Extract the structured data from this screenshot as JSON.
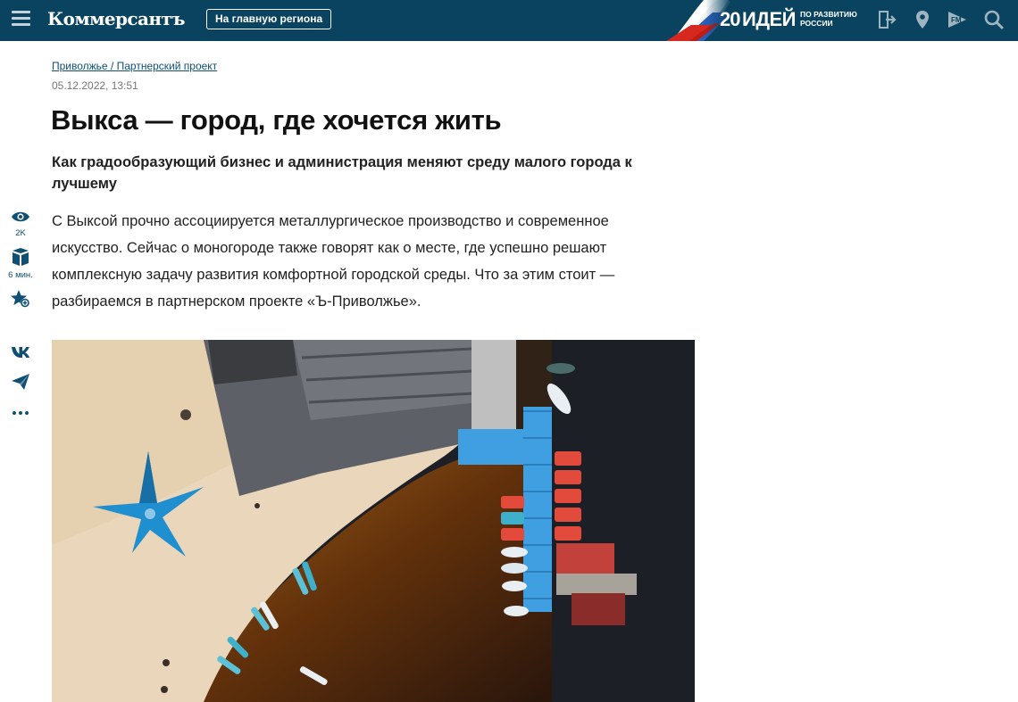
{
  "header": {
    "logo": "Коммерсантъ",
    "region_button": "На главную региона",
    "promo": {
      "number": "20",
      "word": "ИДЕЙ",
      "sub_line1": "ПО РАЗВИТИЮ",
      "sub_line2": "РОССИИ"
    },
    "icons": [
      "login-icon",
      "location-pin-icon",
      "radio-fm-icon",
      "search-icon"
    ]
  },
  "article": {
    "breadcrumb": "Приволжье / Партнерский проект",
    "date": "05.12.2022, 13:51",
    "title": "Выкса — город, где хочется жить",
    "subtitle": "Как градообразующий бизнес и администрация меняют среду малого города к лучшему",
    "lead": "С Выксой прочно ассоциируется металлургическое производство и современное искусство. Сейчас о моногороде также говорят как о месте, где успешно решают комплексную задачу развития комфортной городской среды. Что за этим стоит — разбираемся в партнерском проекте «Ъ-Приволжье»."
  },
  "sidebar": {
    "views": "2K",
    "read_time": "6 мин.",
    "tools": [
      "eye-icon",
      "book-icon",
      "star-add-icon",
      "vk-icon",
      "telegram-icon",
      "more-icon"
    ]
  },
  "colors": {
    "header_bg": "#09435f",
    "accent": "#0f4f73",
    "water": "#1c1f26",
    "sand": "#e9d6bb",
    "tent": "#1f8fd0",
    "pontoon": "#3f9fe0",
    "boat_red": "#e24b3b"
  }
}
